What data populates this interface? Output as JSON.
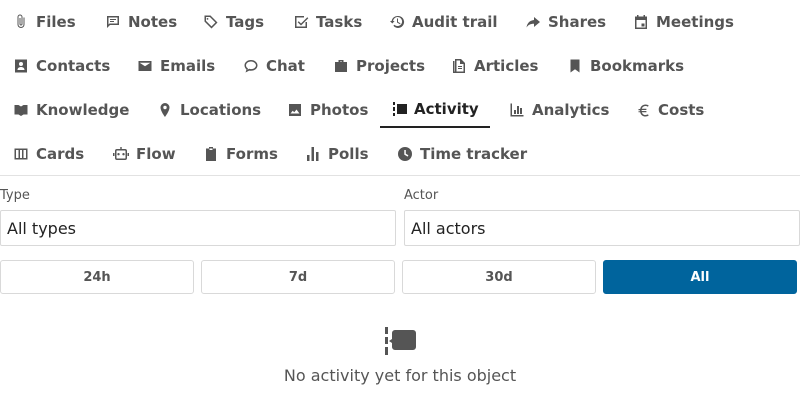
{
  "tabs": [
    {
      "label": "Files",
      "icon": "paperclip-icon"
    },
    {
      "label": "Notes",
      "icon": "note-icon"
    },
    {
      "label": "Tags",
      "icon": "tag-icon"
    },
    {
      "label": "Tasks",
      "icon": "checkbox-icon"
    },
    {
      "label": "Audit trail",
      "icon": "history-icon"
    },
    {
      "label": "Shares",
      "icon": "share-arrow-icon"
    },
    {
      "label": "Meetings",
      "icon": "calendar-icon"
    },
    {
      "label": "Contacts",
      "icon": "contact-card-icon"
    },
    {
      "label": "Emails",
      "icon": "envelope-icon"
    },
    {
      "label": "Chat",
      "icon": "chat-bubble-icon"
    },
    {
      "label": "Projects",
      "icon": "briefcase-icon"
    },
    {
      "label": "Articles",
      "icon": "document-icon"
    },
    {
      "label": "Bookmarks",
      "icon": "bookmark-icon"
    },
    {
      "label": "Knowledge",
      "icon": "book-icon"
    },
    {
      "label": "Locations",
      "icon": "map-pin-icon"
    },
    {
      "label": "Photos",
      "icon": "image-icon"
    },
    {
      "label": "Activity",
      "icon": "activity-timeline-icon"
    },
    {
      "label": "Analytics",
      "icon": "bar-chart-icon"
    },
    {
      "label": "Costs",
      "icon": "euro-icon"
    },
    {
      "label": "Cards",
      "icon": "columns-icon"
    },
    {
      "label": "Flow",
      "icon": "robot-icon"
    },
    {
      "label": "Forms",
      "icon": "clipboard-icon"
    },
    {
      "label": "Polls",
      "icon": "poll-bars-icon"
    },
    {
      "label": "Time tracker",
      "icon": "clock-icon"
    }
  ],
  "active_tab": "Activity",
  "filters": {
    "type_label": "Type",
    "type_value": "All types",
    "actor_label": "Actor",
    "actor_value": "All actors"
  },
  "time_ranges": [
    "24h",
    "7d",
    "30d",
    "All"
  ],
  "active_range": "All",
  "empty_state": {
    "icon": "activity-timeline-icon",
    "message": "No activity yet for this object"
  },
  "colors": {
    "accent": "#00649d",
    "text": "#555555",
    "active_text": "#222222",
    "border": "#d9d9d9"
  }
}
